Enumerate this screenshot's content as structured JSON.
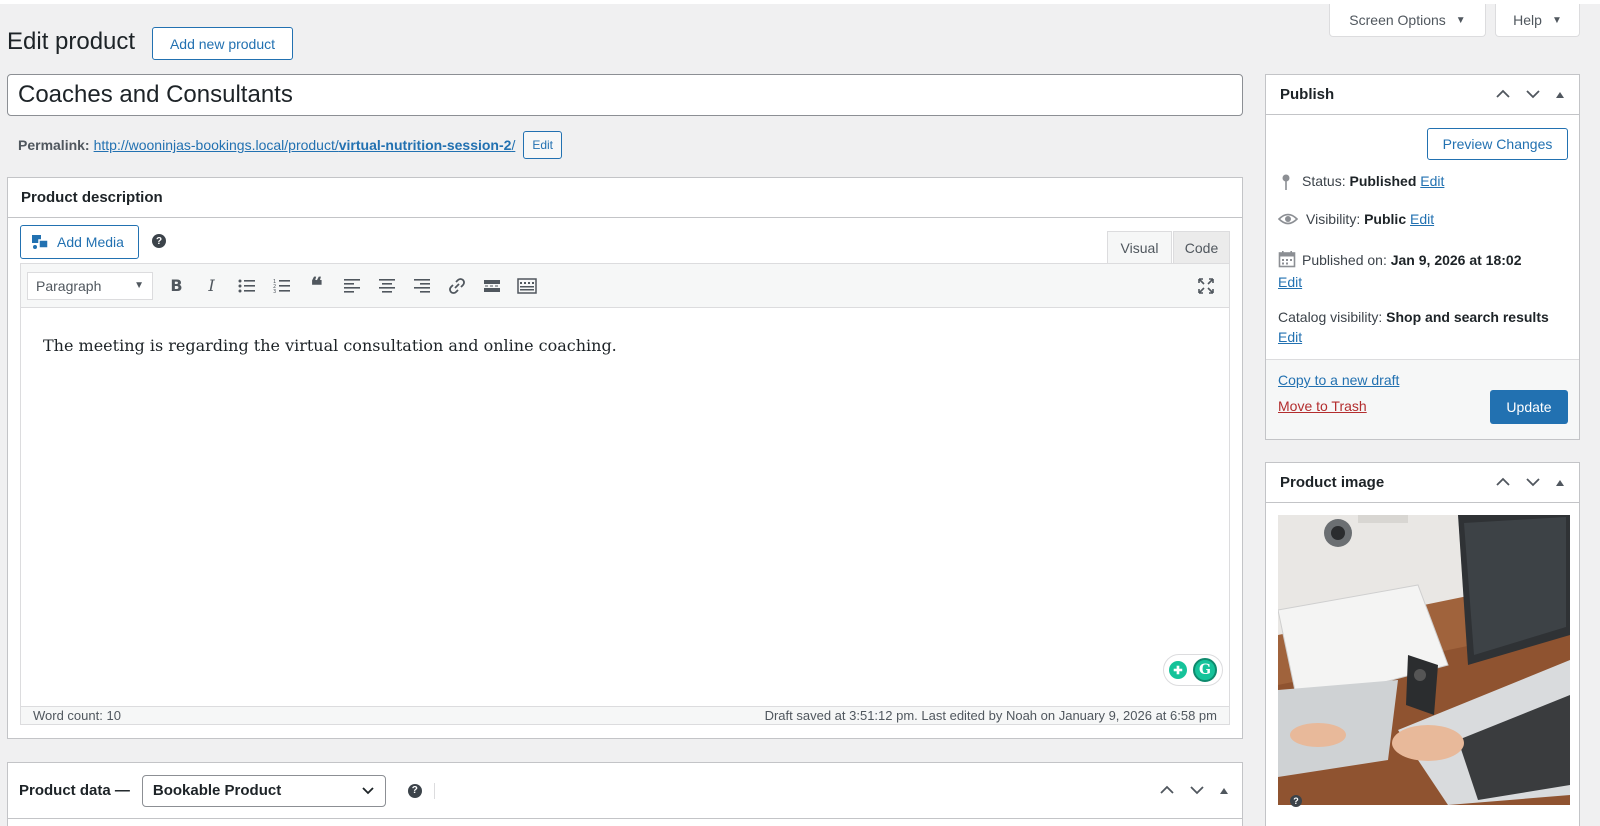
{
  "header": {
    "screen_options_label": "Screen Options",
    "help_label": "Help",
    "page_title": "Edit product",
    "add_new_label": "Add new product"
  },
  "post": {
    "title": "Coaches and Consultants",
    "permalink_label": "Permalink:",
    "permalink_base": "http://wooninjas-bookings.local/product/",
    "permalink_slug": "virtual-nutrition-session-2",
    "permalink_end": "/",
    "permalink_edit_label": "Edit"
  },
  "description": {
    "heading": "Product description",
    "add_media_label": "Add Media",
    "tab_visual": "Visual",
    "tab_code": "Code",
    "format": "Paragraph",
    "content": "The meeting is regarding the virtual consultation and online coaching.",
    "word_count": "Word count: 10",
    "draft_status": "Draft saved at 3:51:12 pm. Last edited by Noah on January 9, 2026 at 6:58 pm"
  },
  "product_data": {
    "label": "Product data —",
    "type": "Bookable Product"
  },
  "publish": {
    "heading": "Publish",
    "preview_label": "Preview Changes",
    "status_label": "Status:",
    "status_value": "Published",
    "visibility_label": "Visibility:",
    "visibility_value": "Public",
    "published_label": "Published on:",
    "published_value": "Jan 9, 2026 at 18:02",
    "catalog_label": "Catalog visibility:",
    "catalog_value": "Shop and search results",
    "edit_label": "Edit",
    "copy_label": "Copy to a new draft",
    "trash_label": "Move to Trash",
    "update_label": "Update"
  },
  "product_image": {
    "heading": "Product image"
  },
  "colors": {
    "accent": "#2271b1",
    "danger": "#b32d2e",
    "background": "#f0f0f1"
  }
}
